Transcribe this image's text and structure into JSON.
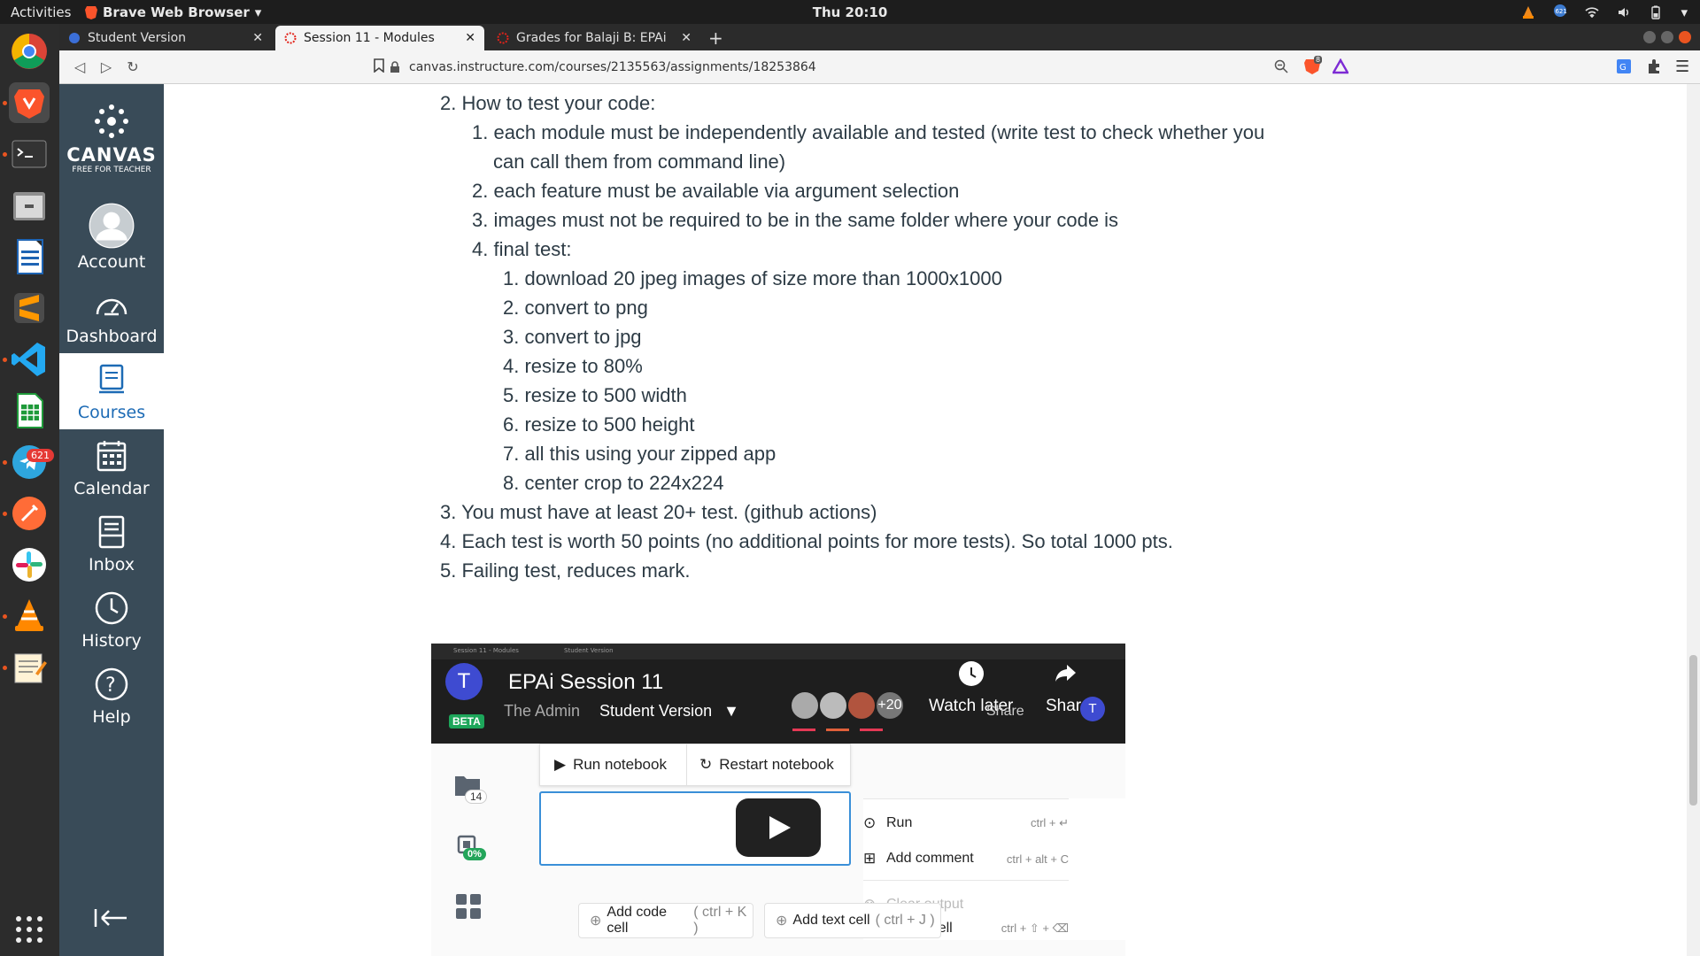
{
  "system": {
    "activities": "Activities",
    "app_name": "Brave Web Browser",
    "clock": "Thu 20:10",
    "brave_badge": "621"
  },
  "dock": {
    "telegram_badge": "621"
  },
  "browser": {
    "tabs": [
      {
        "label": "Student Version"
      },
      {
        "label": "Session 11 - Modules"
      },
      {
        "label": "Grades for Balaji B: EPAi"
      }
    ],
    "url": "canvas.instructure.com/courses/2135563/assignments/18253864",
    "shield_count": "8"
  },
  "canvas": {
    "brand": "CANVAS",
    "brand_sub": "FREE FOR TEACHER",
    "nav": [
      {
        "label": "Account"
      },
      {
        "label": "Dashboard"
      },
      {
        "label": "Courses"
      },
      {
        "label": "Calendar"
      },
      {
        "label": "Inbox"
      },
      {
        "label": "History"
      },
      {
        "label": "Help"
      }
    ]
  },
  "content": {
    "lines": [
      "2. How to test your code:",
      "1. each module must be independently available and tested (write test to check whether you",
      "can call them from command line)",
      "2. each feature must be available via argument selection",
      "3. images must not be required to be in the same folder where your code is",
      "4. final test:",
      "1. download 20 jpeg images of size more than 1000x1000",
      "2. convert to png",
      "3. convert to jpg",
      "4. resize to 80%",
      "5. resize to 500 width",
      "6. resize to 500 height",
      "7. all this using your zipped app",
      "8. center crop to 224x224",
      "3. You must have at least 20+ test. (github actions)",
      "4. Each test is worth 50 points (no additional points for more tests). So total 1000 pts.",
      "5. Failing test, reduces mark."
    ]
  },
  "video": {
    "mini_tabs": [
      "Session 11 - Modules",
      "Student Version"
    ],
    "avatar_letter": "T",
    "title": "EPAi Session 11",
    "author": "The Admin",
    "version": "Student Version",
    "beta": "BETA",
    "plus_count": "+20",
    "watch_later": "Watch later",
    "share": "Share",
    "share_overlay": "Share",
    "share_avatar_letter": "T",
    "files_count": "14",
    "cpu": "0%",
    "run_notebook": "Run notebook",
    "restart_notebook": "Restart notebook",
    "menu": [
      {
        "label": "Run",
        "shortcut": "ctrl + ↵"
      },
      {
        "label": "Add comment",
        "shortcut": "ctrl + alt + C"
      },
      {
        "label": "Clear output",
        "shortcut": ""
      },
      {
        "label": "Delete cell",
        "shortcut": "ctrl + ⇧ + ⌫"
      }
    ],
    "add_code_cell": "Add code cell",
    "add_code_shortcut": "( ctrl + K )",
    "add_text_cell": "Add text cell",
    "add_text_shortcut": "( ctrl + J )"
  },
  "colors": {
    "canvas_nav": "#394b58",
    "canvas_active_text": "#1d6bb5",
    "ubuntu_accent": "#e95420"
  }
}
